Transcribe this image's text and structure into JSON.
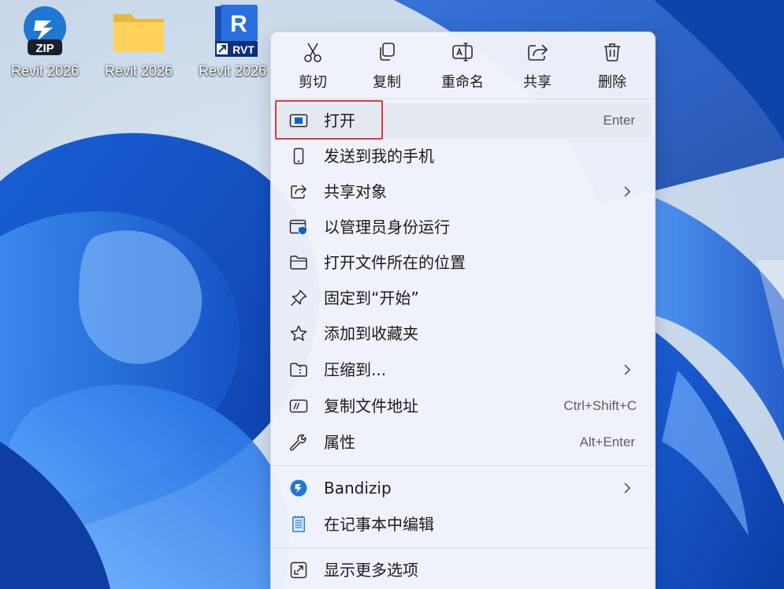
{
  "desktop": {
    "icons": [
      {
        "label": "Revit 2026",
        "icon": "bandizip-zip-icon",
        "badge": "ZIP"
      },
      {
        "label": "Revit 2026",
        "icon": "folder-icon"
      },
      {
        "label": "Revit 2026",
        "icon": "revit-rvt-icon",
        "letter": "R",
        "badge": "RVT"
      }
    ]
  },
  "menu": {
    "toolbar": [
      {
        "label": "剪切",
        "icon": "scissors-icon"
      },
      {
        "label": "复制",
        "icon": "copy-icon"
      },
      {
        "label": "重命名",
        "icon": "rename-icon"
      },
      {
        "label": "共享",
        "icon": "share-icon"
      },
      {
        "label": "删除",
        "icon": "trash-icon"
      }
    ],
    "items": [
      {
        "label": "打开",
        "shortcut": "Enter",
        "icon": "open-app-icon",
        "highlighted": true
      },
      {
        "label": "发送到我的手机",
        "icon": "phone-icon"
      },
      {
        "label": "共享对象",
        "icon": "share-icon",
        "submenu": true
      },
      {
        "label": "以管理员身份运行",
        "icon": "admin-shield-icon"
      },
      {
        "label": "打开文件所在的位置",
        "icon": "folder-icon"
      },
      {
        "label": "固定到“开始”",
        "icon": "pin-icon"
      },
      {
        "label": "添加到收藏夹",
        "icon": "star-icon"
      },
      {
        "label": "压缩到...",
        "icon": "zip-folder-icon",
        "submenu": true
      },
      {
        "label": "复制文件地址",
        "shortcut": "Ctrl+Shift+C",
        "icon": "copy-path-icon"
      },
      {
        "label": "属性",
        "shortcut": "Alt+Enter",
        "icon": "wrench-icon"
      },
      {
        "label": "Bandizip",
        "icon": "bandizip-icon",
        "submenu": true
      },
      {
        "label": "在记事本中编辑",
        "icon": "notepad-icon"
      },
      {
        "label": "显示更多选项",
        "icon": "expand-icon"
      }
    ]
  },
  "colors": {
    "highlight_border": "#e0393a",
    "bandizip_blue": "#1e78d2",
    "revit_blue": "#1a5fcf",
    "icon_stroke": "#2b2b2b",
    "accent_blue": "#0a64c8"
  }
}
